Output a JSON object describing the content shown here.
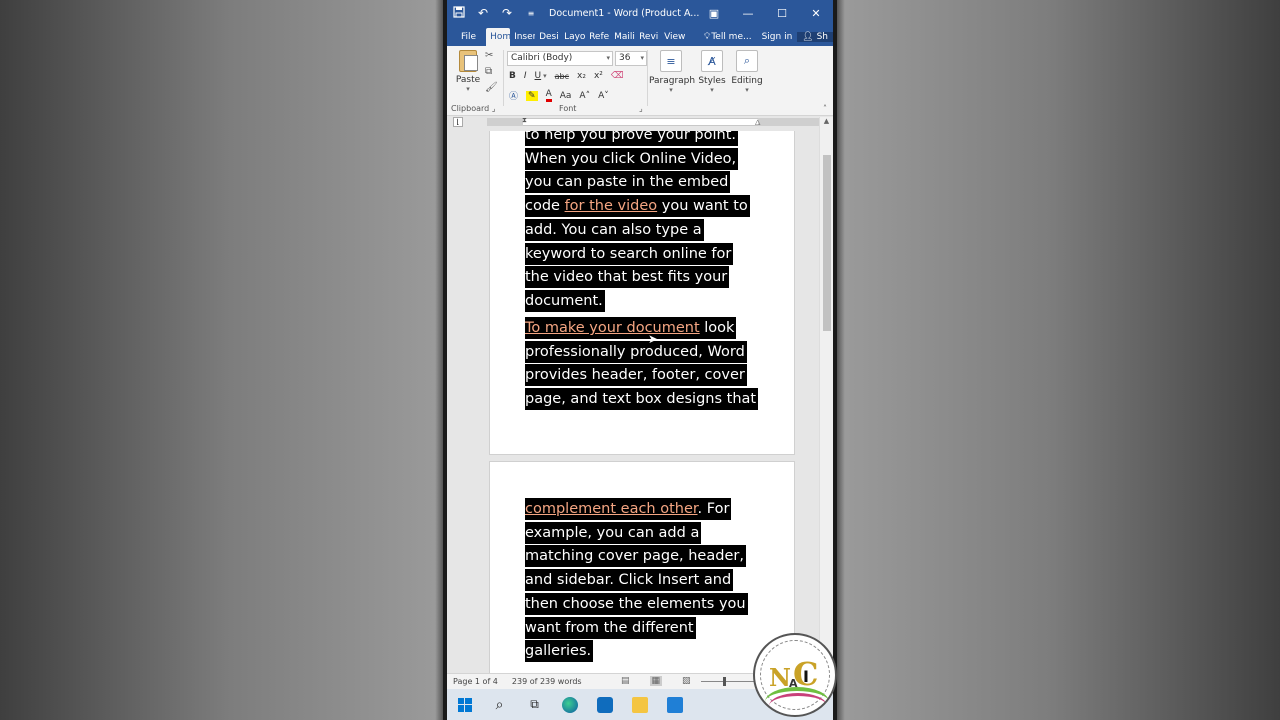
{
  "titlebar": {
    "title": "Document1 - Word (Product A...",
    "save_icon": "save-icon",
    "undo_icon": "undo-icon",
    "redo_icon": "redo-icon"
  },
  "tabs": [
    {
      "label": "File"
    },
    {
      "label": "Hom"
    },
    {
      "label": "Inser"
    },
    {
      "label": "Desi"
    },
    {
      "label": "Layo"
    },
    {
      "label": "Refe"
    },
    {
      "label": "Maili"
    },
    {
      "label": "Revi"
    },
    {
      "label": "View"
    }
  ],
  "tab_right": {
    "tell_me": "Tell me...",
    "sign_in": "Sign in",
    "share": "Sh"
  },
  "ribbon": {
    "paste_label": "Paste",
    "clipboard_label": "Clipboard",
    "font_name": "Calibri (Body)",
    "font_size": "36",
    "font_label": "Font",
    "bold": "B",
    "italic": "I",
    "underline": "U",
    "strike": "abc",
    "subscript": "x₂",
    "superscript": "x²",
    "grow": "A˄",
    "shrink": "A˅",
    "change_case": "Aa",
    "font_color": "A",
    "paragraph_label": "Paragraph",
    "styles_label": "Styles",
    "editing_label": "Editing"
  },
  "document": {
    "page1_lines": [
      {
        "text": "to help you prove your point."
      },
      {
        "text": "When you click Online Video,"
      },
      {
        "text": "you can paste in the embed"
      },
      {
        "pre": "code ",
        "link": "for the video",
        "post": " you want to"
      },
      {
        "text": "add. You can also type a"
      },
      {
        "text": "keyword to search online for"
      },
      {
        "text": "the video that best fits your"
      },
      {
        "text": "document. "
      }
    ],
    "page1_para2": [
      {
        "pre": "",
        "link": "To make your document",
        "post": " look"
      },
      {
        "text": "professionally produced, Word"
      },
      {
        "text": "provides header, footer, cover"
      },
      {
        "text": "page, and text box designs that"
      }
    ],
    "page2_lines": [
      {
        "pre": "",
        "link": "complement each other",
        "post": ". For"
      },
      {
        "text": "example, you can add a"
      },
      {
        "text": "matching cover page, header,"
      },
      {
        "text": "and sidebar. Click Insert and"
      },
      {
        "text": "then choose the elements you"
      },
      {
        "text": "want from the different"
      },
      {
        "text": "galleries. "
      }
    ]
  },
  "status": {
    "page": "Page 1 of 4",
    "words": "239 of 239 words"
  },
  "colors": {
    "word_blue": "#2b579a",
    "highlight": "#000000",
    "link": "#f4a582"
  }
}
